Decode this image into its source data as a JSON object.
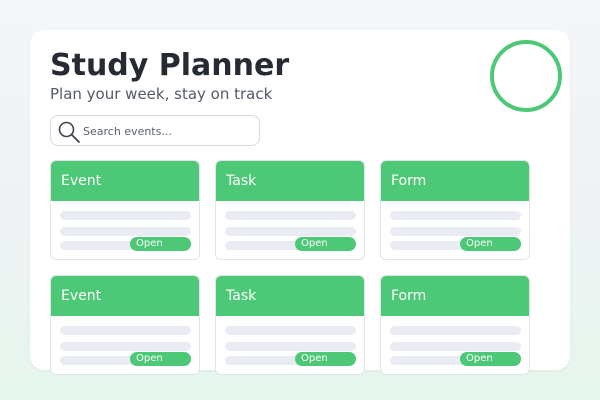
{
  "header": {
    "title": "Study Planner",
    "subtitle": "Plan your week, stay on track"
  },
  "search": {
    "placeholder": "Search events...",
    "icon": "search-icon"
  },
  "colors": {
    "accent": "#4cc877",
    "title_text": "#262a33",
    "skeleton": "#e9ecf2"
  },
  "cards": [
    {
      "title": "Event",
      "action": "Open"
    },
    {
      "title": "Task",
      "action": "Open"
    },
    {
      "title": "Form",
      "action": "Open"
    },
    {
      "title": "Event",
      "action": "Open"
    },
    {
      "title": "Task",
      "action": "Open"
    },
    {
      "title": "Form",
      "action": "Open"
    }
  ]
}
